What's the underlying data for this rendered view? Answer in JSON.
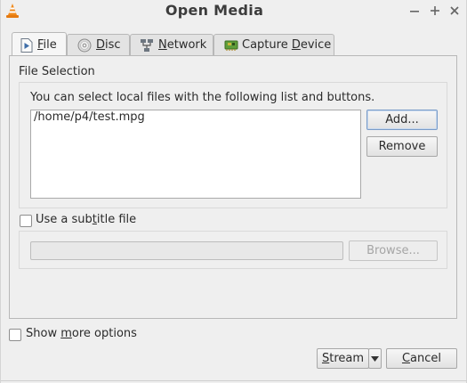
{
  "window": {
    "title": "Open Media",
    "icon": "vlc-cone-icon"
  },
  "tabs": [
    {
      "label_pre": "",
      "mnemonic": "F",
      "label_post": "ile",
      "icon": "file-play-icon",
      "active": true
    },
    {
      "label_pre": "",
      "mnemonic": "D",
      "label_post": "isc",
      "icon": "disc-icon",
      "active": false
    },
    {
      "label_pre": "",
      "mnemonic": "N",
      "label_post": "etwork",
      "icon": "network-icon",
      "active": false
    },
    {
      "label_pre": "Capture ",
      "mnemonic": "D",
      "label_post": "evice",
      "icon": "capture-card-icon",
      "active": false
    }
  ],
  "file_selection": {
    "title": "File Selection",
    "hint": "You can select local files with the following list and buttons.",
    "files": [
      "/home/p4/test.mpg"
    ],
    "add_label": "Add...",
    "remove_label": "Remove"
  },
  "subtitle": {
    "label_pre": "Use a sub",
    "mnemonic": "t",
    "label_post": "itle file",
    "checked": false,
    "path_value": "",
    "browse_label": "Browse..."
  },
  "options": {
    "label_pre": "Show ",
    "mnemonic": "m",
    "label_post": "ore options",
    "checked": false
  },
  "footer": {
    "stream_mnemonic": "S",
    "stream_rest": "tream",
    "cancel_mnemonic": "C",
    "cancel_rest": "ancel"
  }
}
